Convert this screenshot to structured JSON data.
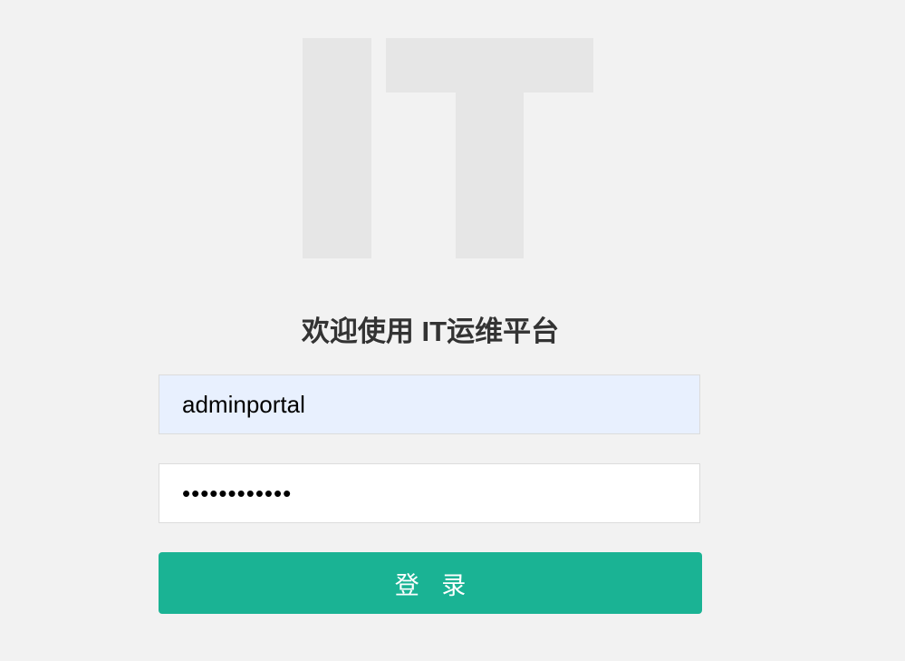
{
  "logo": {
    "text": "IT",
    "color": "#e6e6e6"
  },
  "title": "欢迎使用 IT运维平台",
  "form": {
    "username_value": "adminportal",
    "password_value": "adminportal1",
    "login_label": "登 录"
  },
  "colors": {
    "background": "#f2f2f2",
    "button": "#1ab394",
    "username_autofill_bg": "#e8f0fe"
  }
}
